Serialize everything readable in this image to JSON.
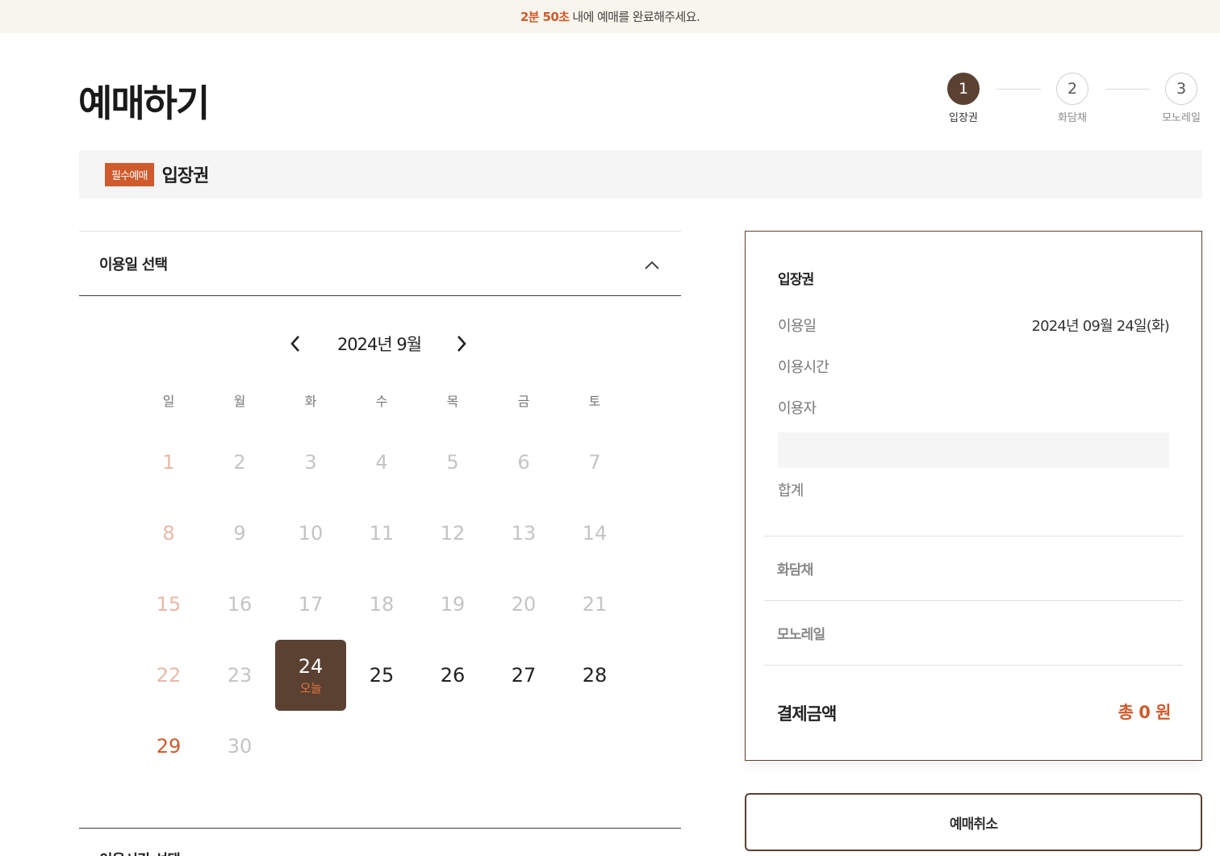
{
  "timer": {
    "time": "2분 50초",
    "message": "내에 예매를 완료해주세요."
  },
  "page": {
    "title": "예매하기"
  },
  "steps": [
    {
      "number": "1",
      "label": "입장권",
      "active": true
    },
    {
      "number": "2",
      "label": "화담채",
      "active": false
    },
    {
      "number": "3",
      "label": "모노레일",
      "active": false
    }
  ],
  "section": {
    "badge": "필수예매",
    "title": "입장권"
  },
  "accordion": {
    "title": "이용일 선택",
    "next_title": "이용시간 선택"
  },
  "calendar": {
    "month_label": "2024년 9월",
    "weekdays": [
      "일",
      "월",
      "화",
      "수",
      "목",
      "금",
      "토"
    ],
    "today_label": "오늘",
    "weeks": [
      [
        "1",
        "2",
        "3",
        "4",
        "5",
        "6",
        "7"
      ],
      [
        "8",
        "9",
        "10",
        "11",
        "12",
        "13",
        "14"
      ],
      [
        "15",
        "16",
        "17",
        "18",
        "19",
        "20",
        "21"
      ],
      [
        "22",
        "23",
        "24",
        "25",
        "26",
        "27",
        "28"
      ],
      [
        "29",
        "30",
        "",
        "",
        "",
        "",
        ""
      ]
    ],
    "selected_day": "24",
    "available_days": [
      "24",
      "25",
      "26",
      "27",
      "28",
      "29"
    ]
  },
  "summary": {
    "heading": "입장권",
    "rows": [
      {
        "label": "이용일",
        "value": "2024년 09월 24일(화)"
      },
      {
        "label": "이용시간",
        "value": ""
      },
      {
        "label": "이용자",
        "value": ""
      }
    ],
    "subtotal_label": "합계",
    "sections": [
      "화담채",
      "모노레일"
    ],
    "total_label": "결제금액",
    "total_value": "총 0 원"
  },
  "buttons": {
    "cancel": "예매취소"
  },
  "colors": {
    "brand_brown": "#5a4132",
    "accent_orange": "#cf5a2c",
    "timer_bg": "#f8f5ec"
  }
}
